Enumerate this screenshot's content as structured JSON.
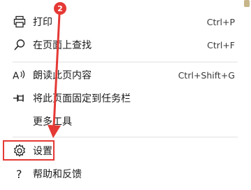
{
  "menu": {
    "items": [
      {
        "label": "打印",
        "shortcut": "Ctrl+P",
        "icon": "print-icon"
      },
      {
        "label": "在页面上查找",
        "shortcut": "Ctrl+F",
        "icon": "search-icon"
      },
      {
        "label": "朗读此页内容",
        "shortcut": "Ctrl+Shift+G",
        "icon": "read-aloud-icon"
      },
      {
        "label": "将此页面固定到任务栏",
        "shortcut": "",
        "icon": "pin-icon"
      },
      {
        "label": "更多工具",
        "shortcut": "",
        "icon": ""
      },
      {
        "label": "设置",
        "shortcut": "",
        "icon": "gear-icon"
      },
      {
        "label": "帮助和反馈",
        "shortcut": "",
        "icon": "help-icon"
      }
    ]
  },
  "annotation": {
    "step_number": "2",
    "color": "#e53935"
  }
}
